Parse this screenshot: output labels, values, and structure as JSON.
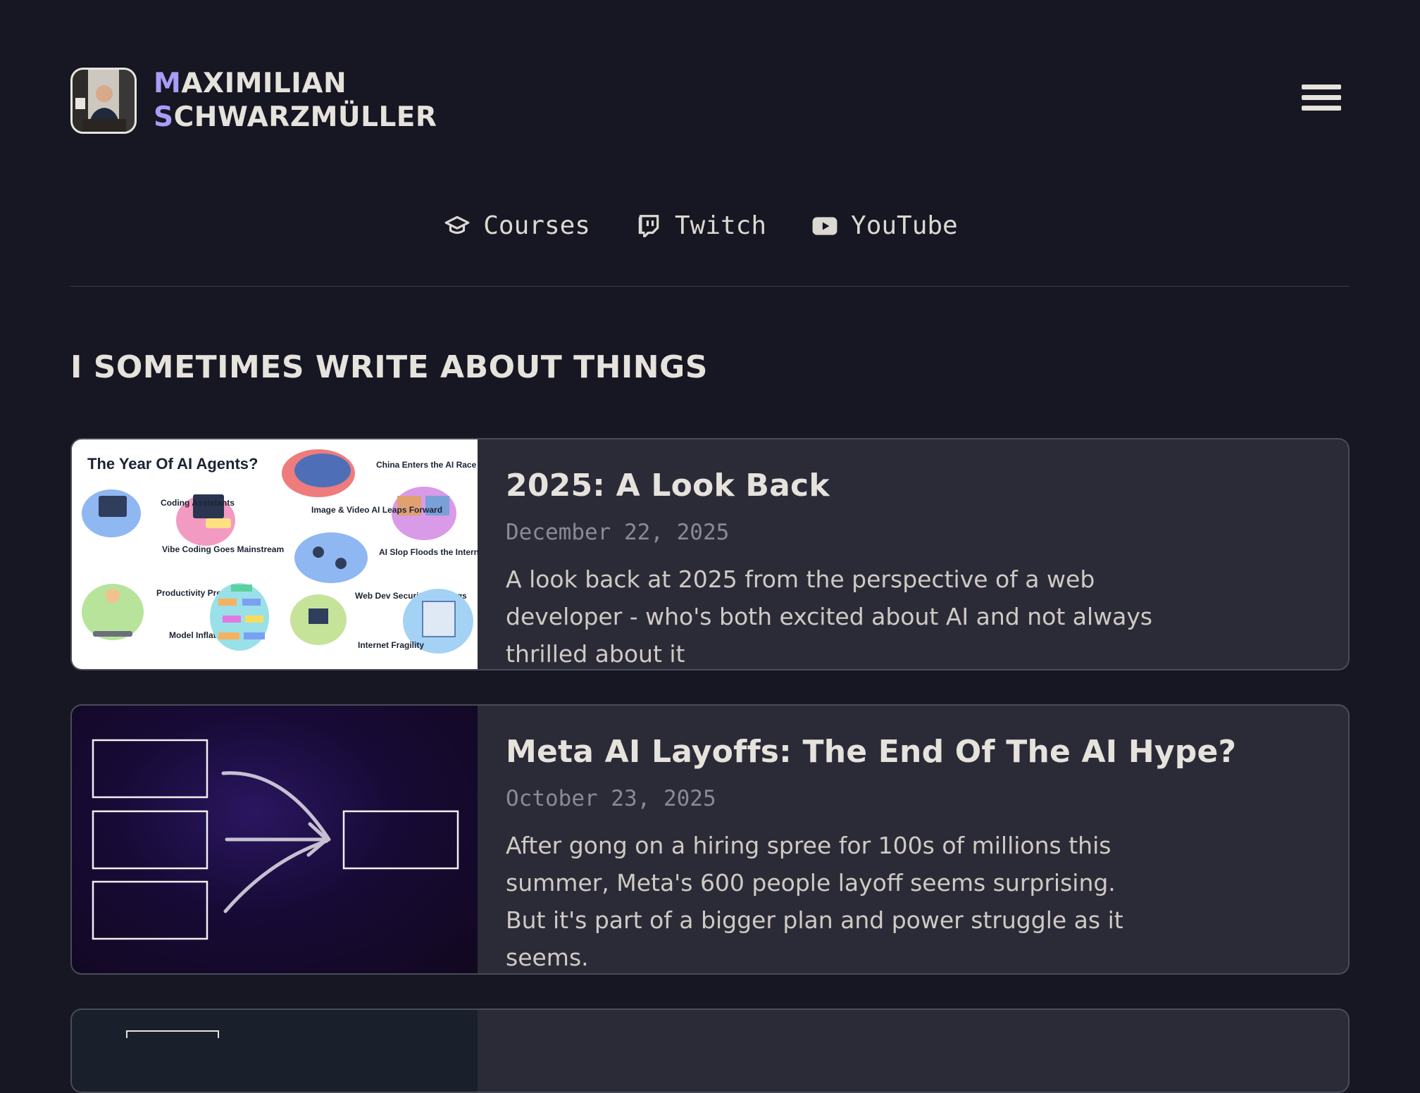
{
  "site": {
    "name_line1_first": "M",
    "name_line1_rest": "AXIMILIAN",
    "name_line2_first": "S",
    "name_line2_rest": "CHWARZMÜLLER"
  },
  "nav": {
    "courses": "Courses",
    "twitch": "Twitch",
    "youtube": "YouTube"
  },
  "section_title": "I SOMETIMES WRITE ABOUT THINGS",
  "posts": [
    {
      "title": "2025: A Look Back",
      "date": "December 22, 2025",
      "description": "A look back at 2025 from the perspective of a web developer - who's both excited about AI and not always thrilled about it",
      "image": {
        "heading": "The Year Of AI Agents?",
        "labels": [
          "Coding Assistants",
          "Vibe Coding Goes Mainstream",
          "Productivity Pressure",
          "Model Inflation",
          "China Enters the AI Race",
          "Image & Video AI Leaps Forward",
          "AI Slop Floods the Internet",
          "Web Dev Security Warnings",
          "Internet Fragility"
        ]
      }
    },
    {
      "title": "Meta AI Layoffs: The End Of The AI Hype?",
      "date": "October 23, 2025",
      "description": "After gong on a hiring spree for 100s of millions this summer, Meta's 600 people layoff seems surprising. But it's part of a bigger plan and power struggle as it seems."
    }
  ],
  "colors": {
    "background": "#161722",
    "card": "#2b2b38",
    "accent": "#a99cf8",
    "text": "#e6e2dc"
  }
}
